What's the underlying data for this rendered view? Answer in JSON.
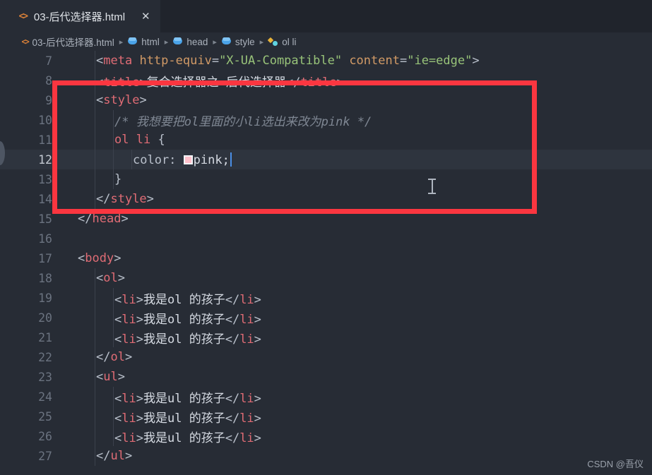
{
  "window": {
    "background_color": "#272c35",
    "accent_color": "#fb3640"
  },
  "tab": {
    "icon": "html-code-icon",
    "title": "03-后代选择器.html",
    "close_label": "✕"
  },
  "breadcrumb": {
    "items": [
      {
        "icon": "html-code-icon",
        "label": "03-后代选择器.html"
      },
      {
        "icon": "cube-icon",
        "label": "html"
      },
      {
        "icon": "cube-icon",
        "label": "head"
      },
      {
        "icon": "cube-icon",
        "label": "style"
      },
      {
        "icon": "css-rule-icon",
        "label": "ol li"
      }
    ],
    "separator": "▸"
  },
  "editor": {
    "active_line": 12,
    "color_swatch_value": "#ffc0cb",
    "lines": [
      {
        "n": "7",
        "indent": 2,
        "tokens": [
          {
            "t": "punc",
            "v": "<"
          },
          {
            "t": "tag",
            "v": "meta"
          },
          {
            "t": "val",
            "v": " "
          },
          {
            "t": "attr",
            "v": "http-equiv"
          },
          {
            "t": "punc",
            "v": "="
          },
          {
            "t": "str",
            "v": "\"X-UA-Compatible\""
          },
          {
            "t": "val",
            "v": " "
          },
          {
            "t": "attr",
            "v": "content"
          },
          {
            "t": "punc",
            "v": "="
          },
          {
            "t": "str",
            "v": "\"ie=edge\""
          },
          {
            "t": "punc",
            "v": ">"
          }
        ]
      },
      {
        "n": "8",
        "indent": 2,
        "tokens": [
          {
            "t": "punc",
            "v": "<"
          },
          {
            "t": "tag",
            "v": "title"
          },
          {
            "t": "punc",
            "v": ">"
          },
          {
            "t": "cn",
            "v": "复合选择器之 后代选择器"
          },
          {
            "t": "punc",
            "v": "</"
          },
          {
            "t": "tag",
            "v": "title"
          },
          {
            "t": "punc",
            "v": ">"
          }
        ]
      },
      {
        "n": "9",
        "indent": 2,
        "tokens": [
          {
            "t": "punc",
            "v": "<"
          },
          {
            "t": "tag",
            "v": "style"
          },
          {
            "t": "punc",
            "v": ">"
          }
        ]
      },
      {
        "n": "10",
        "indent": 3,
        "tokens": [
          {
            "t": "cmt",
            "v": "/* 我想要把ol里面的小li选出来改为pink */"
          }
        ]
      },
      {
        "n": "11",
        "indent": 3,
        "tokens": [
          {
            "t": "sel",
            "v": "ol li"
          },
          {
            "t": "val",
            "v": " "
          },
          {
            "t": "brace",
            "v": "{"
          }
        ]
      },
      {
        "n": "12",
        "indent": 4,
        "tokens": [
          {
            "t": "prop",
            "v": "color:"
          },
          {
            "t": "val",
            "v": " "
          },
          {
            "t": "swatch",
            "v": ""
          },
          {
            "t": "val",
            "v": "pink;"
          },
          {
            "t": "caret",
            "v": ""
          }
        ]
      },
      {
        "n": "13",
        "indent": 3,
        "tokens": [
          {
            "t": "brace",
            "v": "}"
          }
        ]
      },
      {
        "n": "14",
        "indent": 2,
        "tokens": [
          {
            "t": "punc",
            "v": "</"
          },
          {
            "t": "tag",
            "v": "style"
          },
          {
            "t": "punc",
            "v": ">"
          }
        ]
      },
      {
        "n": "15",
        "indent": 1,
        "tokens": [
          {
            "t": "punc",
            "v": "</"
          },
          {
            "t": "tag",
            "v": "head"
          },
          {
            "t": "punc",
            "v": ">"
          }
        ]
      },
      {
        "n": "16",
        "indent": 1,
        "tokens": []
      },
      {
        "n": "17",
        "indent": 1,
        "tokens": [
          {
            "t": "punc",
            "v": "<"
          },
          {
            "t": "tag",
            "v": "body"
          },
          {
            "t": "punc",
            "v": ">"
          }
        ]
      },
      {
        "n": "18",
        "indent": 2,
        "tokens": [
          {
            "t": "punc",
            "v": "<"
          },
          {
            "t": "tag",
            "v": "ol"
          },
          {
            "t": "punc",
            "v": ">"
          }
        ]
      },
      {
        "n": "19",
        "indent": 3,
        "tokens": [
          {
            "t": "punc",
            "v": "<"
          },
          {
            "t": "tag",
            "v": "li"
          },
          {
            "t": "punc",
            "v": ">"
          },
          {
            "t": "cn",
            "v": "我是ol 的孩子"
          },
          {
            "t": "punc",
            "v": "</"
          },
          {
            "t": "tag",
            "v": "li"
          },
          {
            "t": "punc",
            "v": ">"
          }
        ]
      },
      {
        "n": "20",
        "indent": 3,
        "tokens": [
          {
            "t": "punc",
            "v": "<"
          },
          {
            "t": "tag",
            "v": "li"
          },
          {
            "t": "punc",
            "v": ">"
          },
          {
            "t": "cn",
            "v": "我是ol 的孩子"
          },
          {
            "t": "punc",
            "v": "</"
          },
          {
            "t": "tag",
            "v": "li"
          },
          {
            "t": "punc",
            "v": ">"
          }
        ]
      },
      {
        "n": "21",
        "indent": 3,
        "tokens": [
          {
            "t": "punc",
            "v": "<"
          },
          {
            "t": "tag",
            "v": "li"
          },
          {
            "t": "punc",
            "v": ">"
          },
          {
            "t": "cn",
            "v": "我是ol 的孩子"
          },
          {
            "t": "punc",
            "v": "</"
          },
          {
            "t": "tag",
            "v": "li"
          },
          {
            "t": "punc",
            "v": ">"
          }
        ]
      },
      {
        "n": "22",
        "indent": 2,
        "tokens": [
          {
            "t": "punc",
            "v": "</"
          },
          {
            "t": "tag",
            "v": "ol"
          },
          {
            "t": "punc",
            "v": ">"
          }
        ]
      },
      {
        "n": "23",
        "indent": 2,
        "tokens": [
          {
            "t": "punc",
            "v": "<"
          },
          {
            "t": "tag",
            "v": "ul"
          },
          {
            "t": "punc",
            "v": ">"
          }
        ]
      },
      {
        "n": "24",
        "indent": 3,
        "tokens": [
          {
            "t": "punc",
            "v": "<"
          },
          {
            "t": "tag",
            "v": "li"
          },
          {
            "t": "punc",
            "v": ">"
          },
          {
            "t": "cn",
            "v": "我是ul 的孩子"
          },
          {
            "t": "punc",
            "v": "</"
          },
          {
            "t": "tag",
            "v": "li"
          },
          {
            "t": "punc",
            "v": ">"
          }
        ]
      },
      {
        "n": "25",
        "indent": 3,
        "tokens": [
          {
            "t": "punc",
            "v": "<"
          },
          {
            "t": "tag",
            "v": "li"
          },
          {
            "t": "punc",
            "v": ">"
          },
          {
            "t": "cn",
            "v": "我是ul 的孩子"
          },
          {
            "t": "punc",
            "v": "</"
          },
          {
            "t": "tag",
            "v": "li"
          },
          {
            "t": "punc",
            "v": ">"
          }
        ]
      },
      {
        "n": "26",
        "indent": 3,
        "tokens": [
          {
            "t": "punc",
            "v": "<"
          },
          {
            "t": "tag",
            "v": "li"
          },
          {
            "t": "punc",
            "v": ">"
          },
          {
            "t": "cn",
            "v": "我是ul 的孩子"
          },
          {
            "t": "punc",
            "v": "</"
          },
          {
            "t": "tag",
            "v": "li"
          },
          {
            "t": "punc",
            "v": ">"
          }
        ]
      },
      {
        "n": "27",
        "indent": 2,
        "tokens": [
          {
            "t": "punc",
            "v": "</"
          },
          {
            "t": "tag",
            "v": "ul"
          },
          {
            "t": "punc",
            "v": ">"
          }
        ]
      }
    ]
  },
  "annotation": {
    "highlight_color": "#fb3640",
    "shape": "rectangle"
  },
  "watermark": {
    "text": "CSDN @吾仪"
  }
}
